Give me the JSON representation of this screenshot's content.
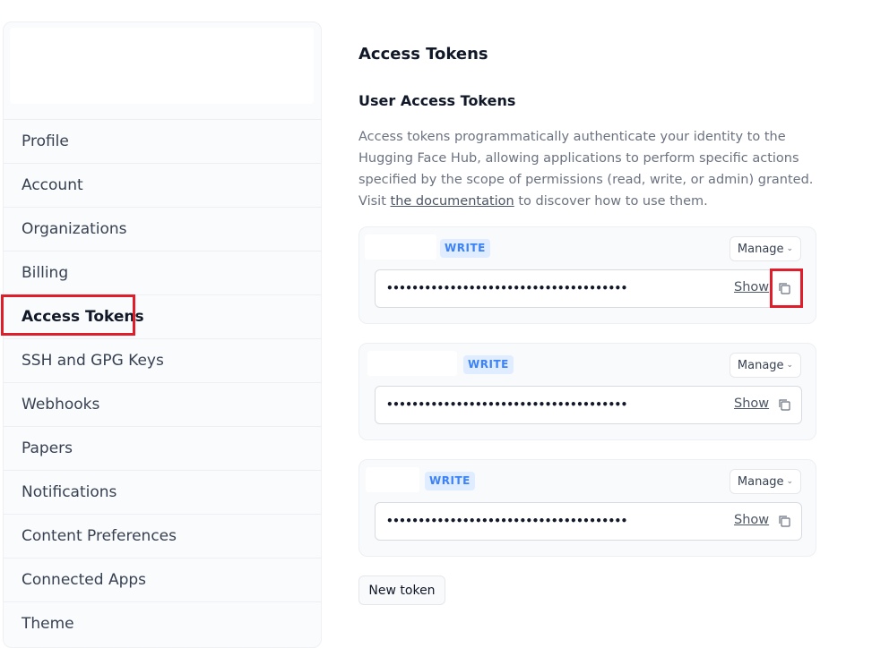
{
  "sidebar": {
    "items": [
      {
        "label": "Profile"
      },
      {
        "label": "Account"
      },
      {
        "label": "Organizations"
      },
      {
        "label": "Billing"
      },
      {
        "label": "Access Tokens"
      },
      {
        "label": "SSH and GPG Keys"
      },
      {
        "label": "Webhooks"
      },
      {
        "label": "Papers"
      },
      {
        "label": "Notifications"
      },
      {
        "label": "Content Preferences"
      },
      {
        "label": "Connected Apps"
      },
      {
        "label": "Theme"
      }
    ],
    "active": "Access Tokens"
  },
  "main": {
    "title": "Access Tokens",
    "subtitle": "User Access Tokens",
    "description_before": "Access tokens programmatically authenticate your identity to the Hugging Face Hub, allowing applications to perform specific actions specified by the scope of permissions (read, write, or admin) granted. Visit ",
    "description_link": "the documentation",
    "description_after": " to discover how to use them.",
    "tokens": [
      {
        "role": "WRITE",
        "manage_label": "Manage",
        "value": "••••••••••••••••••••••••••••••••••••••",
        "show_label": "Show"
      },
      {
        "role": "WRITE",
        "manage_label": "Manage",
        "value": "••••••••••••••••••••••••••••••••••••••",
        "show_label": "Show"
      },
      {
        "role": "WRITE",
        "manage_label": "Manage",
        "value": "••••••••••••••••••••••••••••••••••••••",
        "show_label": "Show"
      }
    ],
    "new_token_label": "New token"
  },
  "icons": {
    "copy": "copy-icon",
    "manage_dropdown": "chevron-down-icon"
  },
  "colors": {
    "highlight": "#e01e2b",
    "badge_bg": "#e0ecff",
    "badge_text": "#3b82f6"
  }
}
